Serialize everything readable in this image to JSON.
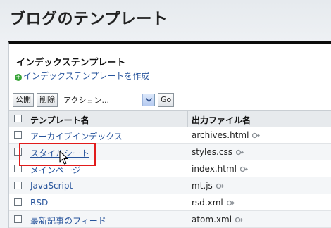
{
  "page": {
    "title": "ブログのテンプレート"
  },
  "panel": {
    "title": "インデックステンプレート",
    "create_link": "インデックステンプレートを作成",
    "toolbar": {
      "publish_label": "公開",
      "delete_label": "削除",
      "action_selected": "アクション...",
      "go_label": "Go"
    },
    "columns": {
      "name": "テンプレート名",
      "output": "出力ファイル名"
    },
    "rows": [
      {
        "name": "アーカイブインデックス",
        "file": "archives.html"
      },
      {
        "name": "スタイルシート",
        "file": "styles.css"
      },
      {
        "name": "メインページ",
        "file": "index.html"
      },
      {
        "name": "JavaScript",
        "file": "mt.js"
      },
      {
        "name": "RSD",
        "file": "rsd.xml"
      },
      {
        "name": "最新記事のフィード",
        "file": "atom.xml"
      }
    ]
  },
  "colors": {
    "link": "#27549c",
    "highlight": "#e11b1b",
    "panel_top_bar": "#0b0b0b"
  },
  "icons": {
    "create": "plus-circle-icon",
    "dropdown": "chevron-down-icon",
    "view_published": "external-link-icon",
    "cursor": "mouse-pointer-icon"
  }
}
